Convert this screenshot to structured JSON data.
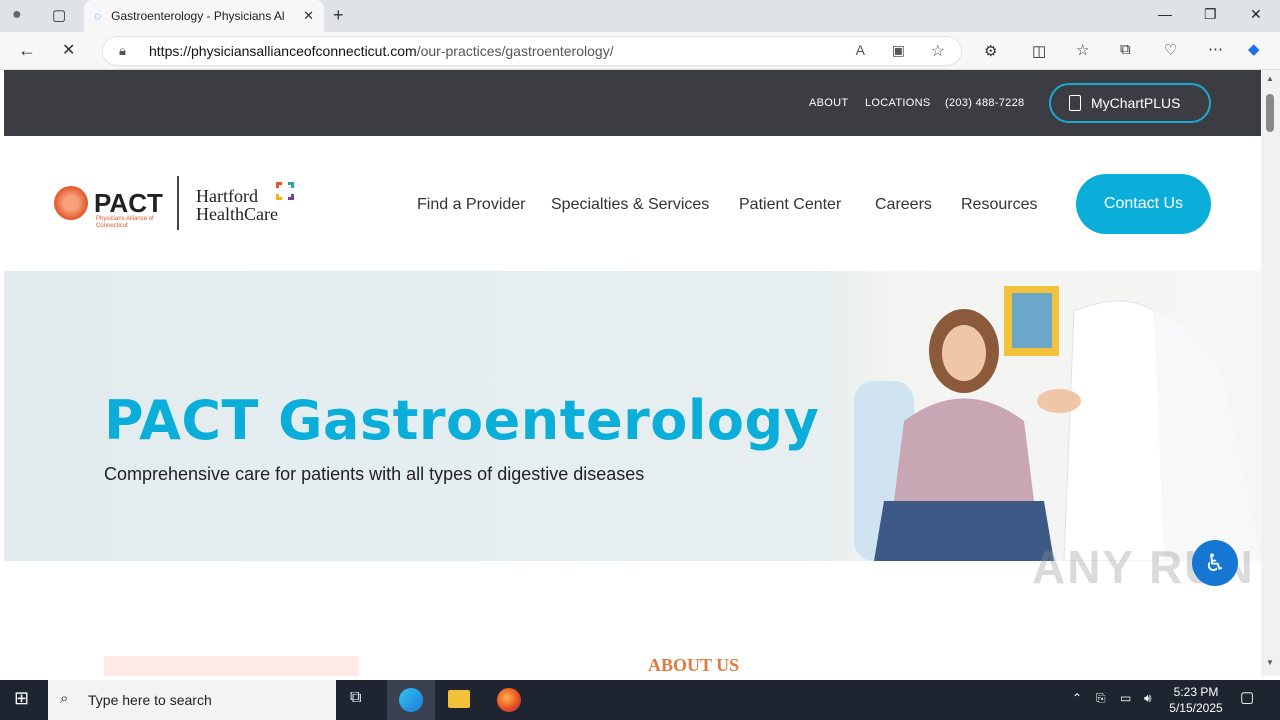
{
  "browser": {
    "tab_title": "Gastroenterology - Physicians Alli",
    "url_domain": "https://physiciansallianceofconnecticut.com",
    "url_path": "/our-practices/gastroenterology/"
  },
  "utility_nav": {
    "about": "ABOUT",
    "locations": "LOCATIONS",
    "phone": "(203) 488-7228",
    "mychart": "MyChartPLUS"
  },
  "logo": {
    "pact": "PACT",
    "pact_sub": "Physicians Alliance of Connecticut",
    "hhc_line1": "Hartford",
    "hhc_line2": "HealthCare"
  },
  "main_nav": [
    "Find a Provider",
    "Specialties & Services",
    "Patient Center",
    "Careers",
    "Resources"
  ],
  "contact_button": "Contact Us",
  "hero": {
    "title": "PACT Gastroenterology",
    "subtitle": "Comprehensive care for patients with all types of digestive diseases"
  },
  "about_heading": "ABOUT US",
  "watermark": "ANY RUN",
  "taskbar": {
    "search_placeholder": "Type here to search",
    "time": "5:23 PM",
    "date": "5/15/2025"
  },
  "colors": {
    "accent": "#0aaed9",
    "dark_strip": "#3c3d42",
    "about_orange": "#e07a3c"
  }
}
